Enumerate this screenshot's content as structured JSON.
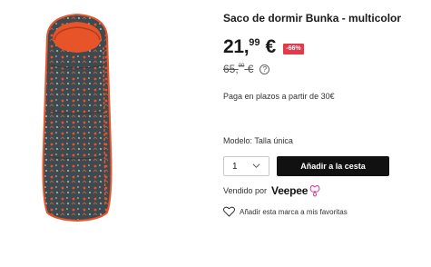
{
  "product": {
    "image_alt": "sleeping-bag-image",
    "title": "Saco de dormir Bunka - multicolor"
  },
  "price": {
    "integer": "21,",
    "decimals": "99",
    "currency": "€",
    "discount": "-66%",
    "old_integer": "65,",
    "old_decimals": "00",
    "old_currency": "€",
    "info_icon": "?"
  },
  "installments": "Paga en plazos a partir de 30€",
  "model": "Modelo: Talla única",
  "quantity": {
    "selected": "1"
  },
  "add_to_cart_label": "Añadir a la cesta",
  "seller": {
    "label": "Vendido por",
    "brand": "Veepee"
  },
  "favorites_label": "Añadir esta marca a mis favoritas",
  "colors": {
    "badge": "#e5384a",
    "button": "#111111",
    "brand_accent": "#d43ea0",
    "bag_main": "#3f4a50",
    "bag_lining": "#e8542a"
  }
}
